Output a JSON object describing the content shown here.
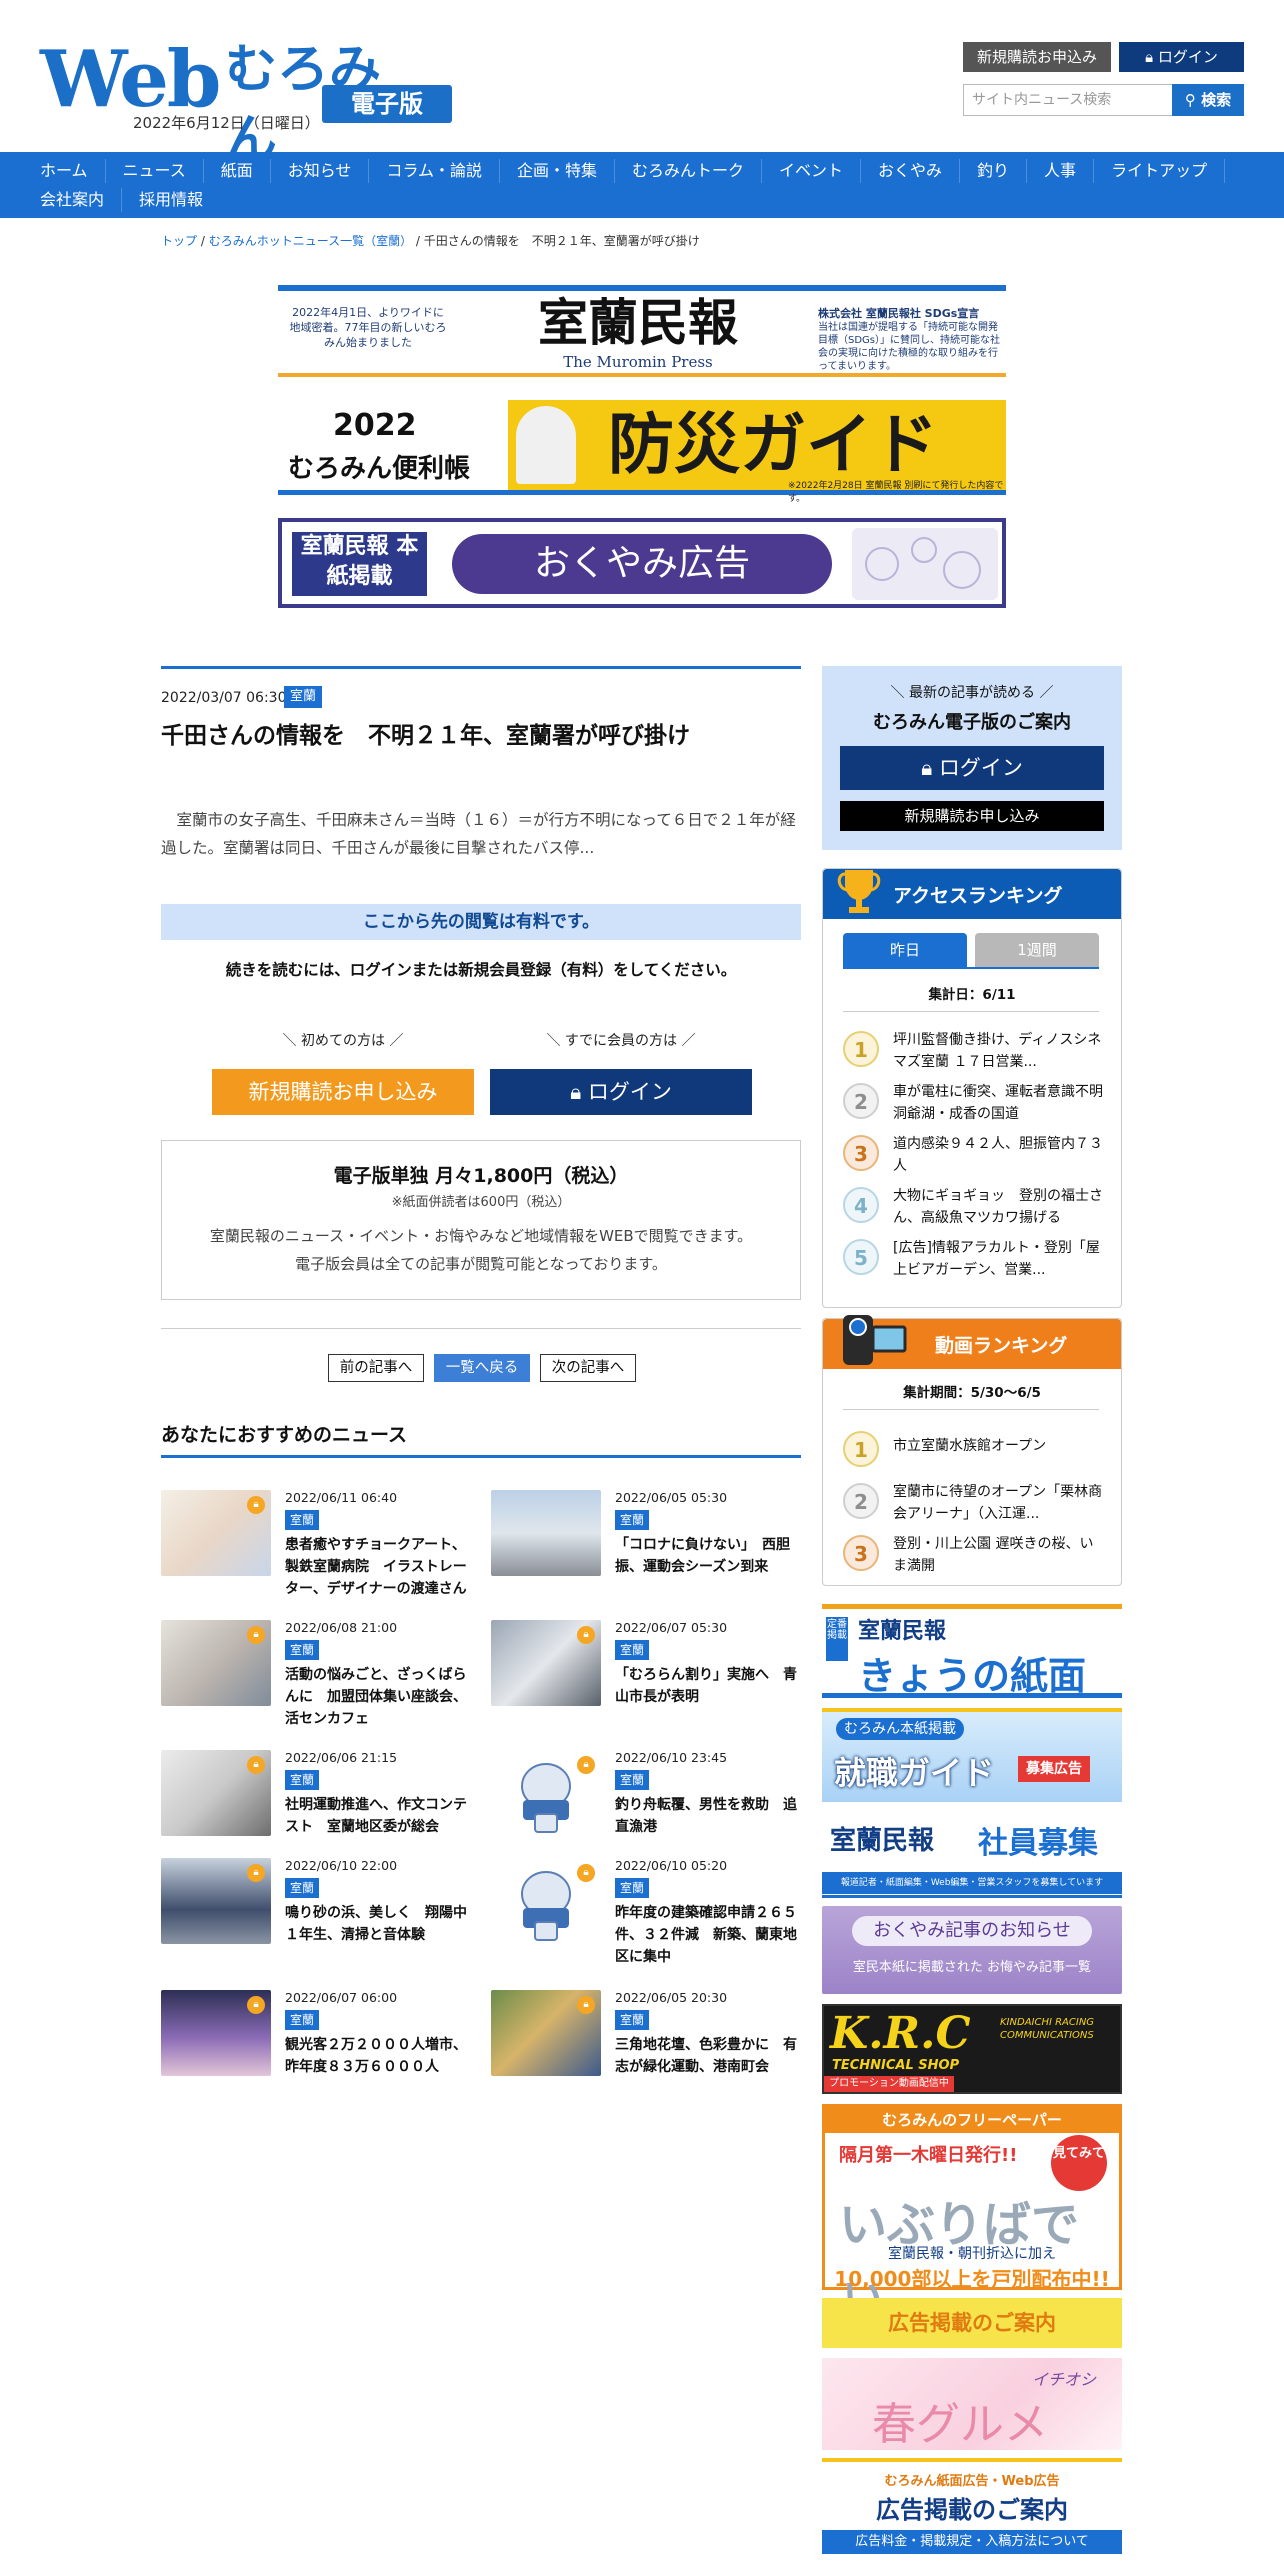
{
  "header": {
    "logo_web": "Web",
    "logo_muromin": "むろみん",
    "logo_denshi": "電子版",
    "date": "2022年6月12日（日曜日）",
    "signup_label": "新規購読お申込み",
    "login_label": "ログイン",
    "search_placeholder": "サイト内ニュース検索",
    "search_button": "検索"
  },
  "nav": {
    "row1": [
      "ホーム",
      "ニュース",
      "紙面",
      "お知らせ",
      "コラム・論説",
      "企画・特集",
      "むろみんトーク",
      "イベント",
      "おくやみ",
      "釣り",
      "人事",
      "ライトアップ"
    ],
    "row2": [
      "会社案内",
      "採用情報"
    ]
  },
  "breadcrumb": {
    "top": "トップ",
    "list": "むろみんホットニュース一覧（室蘭）",
    "current": "千田さんの情報を　不明２１年、室蘭署が呼び掛け"
  },
  "banners": {
    "muromin_left": "2022年4月1日、よりワイドに地域密着。77年目の新しいむろみん始まりました",
    "muromin_mid": "室蘭民報",
    "muromin_mid_sub": "The Muromin Press",
    "muromin_right_title": "株式会社 室蘭民報社 SDGs宣言",
    "muromin_right_text": "当社は国連が提唱する「持続可能な開発目標（SDGs）」に賛同し、持続可能な社会の実現に向けた積極的な取り組みを行ってまいります。",
    "bousai_year": "2022",
    "bousai_bench": "むろみん便利帳",
    "bousai_title": "防災ガイド",
    "bousai_note": "※2022年2月28日 室蘭民報 別刷にて発行した内容です。",
    "okuyami_left": "室蘭民報 本紙掲載",
    "okuyami_title": "おくやみ広告"
  },
  "article": {
    "date": "2022/03/07 06:30",
    "category": "室蘭",
    "title": "千田さんの情報を　不明２１年、室蘭署が呼び掛け",
    "lead": "室蘭市の女子高生、千田麻未さん＝当時（１６）＝が行方不明になって６日で２１年が経過した。室蘭署は同日、千田さんが最後に目撃されたバス停...",
    "paywall_bar": "ここから先の閲覧は有料です。",
    "paywall_msg": "続きを読むには、ログインまたは新規会員登録（有料）をしてください。",
    "label_first": "＼ 初めての方は ／",
    "label_member": "＼ すでに会員の方は ／",
    "signup_button": "新規購読お申し込み",
    "login_button": "ログイン",
    "price_title": "電子版単独 月々1,800円（税込）",
    "price_note": "※紙面併読者は600円（税込）",
    "price_desc1": "室蘭民報のニュース・イベント・お悔やみなど地域情報をWEBで閲覧できます。",
    "price_desc2": "電子版会員は全ての記事が閲覧可能となっております。",
    "prev": "前の記事へ",
    "list": "一覧へ戻る",
    "next": "次の記事へ"
  },
  "recommend": {
    "title": "あなたにおすすめのニュース",
    "items": [
      {
        "date": "2022/06/11 06:40",
        "category": "室蘭",
        "text": "患者癒やすチョークアート、製鉄室蘭病院　イラストレーター、デザイナーの渡達さん"
      },
      {
        "date": "2022/06/05 05:30",
        "category": "室蘭",
        "text": "「コロナに負けない」　西胆振、運動会シーズン到来"
      },
      {
        "date": "2022/06/08 21:00",
        "category": "室蘭",
        "text": "活動の悩みごと、ざっくばらんに　加盟団体集い座談会、活センカフェ"
      },
      {
        "date": "2022/06/07 05:30",
        "category": "室蘭",
        "text": "「むろらん割り」実施へ　青山市長が表明"
      },
      {
        "date": "2022/06/06 21:15",
        "category": "室蘭",
        "text": "社明運動推進へ、作文コンテスト　室蘭地区委が総会"
      },
      {
        "date": "2022/06/10 23:45",
        "category": "室蘭",
        "text": "釣り舟転覆、男性を救助　追直漁港"
      },
      {
        "date": "2022/06/10 22:00",
        "category": "室蘭",
        "text": "鳴り砂の浜、美しく　翔陽中１年生、清掃と音体験"
      },
      {
        "date": "2022/06/10 05:20",
        "category": "室蘭",
        "text": "昨年度の建築確認申請２６５件、３２件減　新築、蘭東地区に集中"
      },
      {
        "date": "2022/06/07 06:00",
        "category": "室蘭",
        "text": "観光客２万２０００人増市、昨年度８３万６０００人"
      },
      {
        "date": "2022/06/05 20:30",
        "category": "室蘭",
        "text": "三角地花壇、色彩豊かに　有志が緑化運動、港南町会"
      }
    ]
  },
  "sidebar": {
    "member_sub": "＼ 最新の記事が読める ／",
    "member_title": "むろみん電子版のご案内",
    "login": "ログイン",
    "signup": "新規購読お申し込み",
    "ranking_title": "アクセスランキング",
    "tab_yesterday": "昨日",
    "tab_week": "1週間",
    "ranking_period": "集計日：6/11",
    "ranking_items": [
      {
        "rank": "1",
        "text": "坪川監督働き掛け、ディノスシネマズ室蘭 １７日営業..."
      },
      {
        "rank": "2",
        "text": "車が電柱に衝突、運転者意識不明　洞爺湖・成香の国道"
      },
      {
        "rank": "3",
        "text": "道内感染９４２人、胆振管内７３人"
      },
      {
        "rank": "4",
        "text": "大物にギョギョッ　登別の福士さん、高級魚マツカワ揚げる"
      },
      {
        "rank": "5",
        "text": "[広告]情報アラカルト・登別「屋上ビアガーデン、営業..."
      }
    ],
    "video_title": "動画ランキング",
    "video_period": "集計期間：5/30〜6/5",
    "video_items": [
      {
        "rank": "1",
        "text": "市立室蘭水族館オープン"
      },
      {
        "rank": "2",
        "text": "室蘭市に待望のオープン「栗林商会アリーナ」（入江運..."
      },
      {
        "rank": "3",
        "text": "登別・川上公園 遅咲きの桜、いま満開"
      }
    ],
    "banner_kyou_tag": "定番掲載",
    "banner_kyou_brand": "室蘭民報",
    "banner_kyou_title": "きょうの紙面",
    "banner_shushoku_tag": "むろみん本紙掲載",
    "banner_shushoku_title": "就職ガイド",
    "banner_shushoku_badge": "募集広告",
    "banner_shain_brand": "室蘭民報",
    "banner_shain_title": "社員募集",
    "banner_shain_sub": "報道記者・紙面編集・Web編集・営業スタッフを募集しています",
    "banner_okuyami_title": "おくやみ記事のお知らせ",
    "banner_okuyami_sub": "室民本紙に掲載された お悔やみ記事一覧",
    "banner_krc_title": "K.R.C",
    "banner_krc_sub": "TECHNICAL SHOP",
    "banner_krc_right": "KINDAICHI RACING COMMUNICATIONS",
    "banner_krc_promo": "プロモーション動画配信中",
    "banner_free_head": "むろみんのフリーペーパー",
    "banner_free_issue": "隔月第一木曜日発行!!",
    "banner_free_see": "見てみて",
    "banner_free_title": "いぶりばでぃ",
    "banner_free_note": "室蘭民報・朝刊折込に加え",
    "banner_free_count": "10,000部以上を戸別配布中!!",
    "banner_ad_title": "広告掲載のご案内",
    "banner_spring_tag": "イチオシ",
    "banner_spring_title": "春グルメ",
    "banner_ad2_sub": "むろみん紙面広告・Web広告",
    "banner_ad2_title": "広告掲載のご案内",
    "banner_ad2_foot": "広告料金・掲載規定・入稿方法について"
  }
}
